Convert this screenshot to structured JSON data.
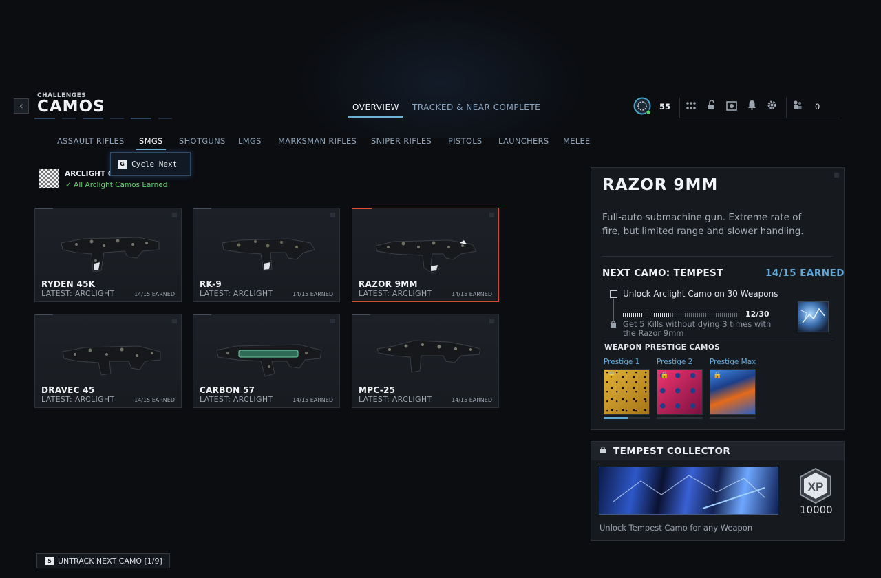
{
  "header": {
    "breadcrumb": "CHALLENGES",
    "title": "CAMOS",
    "back_icon": "chevron-left-icon",
    "tabs": [
      {
        "label": "OVERVIEW",
        "active": true
      },
      {
        "label": "TRACKED & NEAR COMPLETE",
        "active": false
      }
    ],
    "level": "55",
    "party_count": "0"
  },
  "weapon_classes": [
    "ASSAULT RIFLES",
    "SMGS",
    "SHOTGUNS",
    "LMGS",
    "MARKSMAN RIFLES",
    "SNIPER RIFLES",
    "PISTOLS",
    "LAUNCHERS",
    "MELEE"
  ],
  "active_class": "SMGS",
  "tooltip": {
    "key": "G",
    "label": "Cycle Next"
  },
  "arclight": {
    "title": "ARCLIGHT CA",
    "status": "All Arclight Camos Earned"
  },
  "weapons": [
    {
      "name": "RYDEN 45K",
      "latest": "LATEST: ARCLIGHT",
      "earned": "14/15 EARNED",
      "selected": false
    },
    {
      "name": "RK-9",
      "latest": "LATEST: ARCLIGHT",
      "earned": "14/15 EARNED",
      "selected": false
    },
    {
      "name": "RAZOR 9MM",
      "latest": "LATEST: ARCLIGHT",
      "earned": "14/15 EARNED",
      "selected": true
    },
    {
      "name": "DRAVEC 45",
      "latest": "LATEST: ARCLIGHT",
      "earned": "14/15 EARNED",
      "selected": false
    },
    {
      "name": "CARBON 57",
      "latest": "LATEST: ARCLIGHT",
      "earned": "14/15 EARNED",
      "selected": false
    },
    {
      "name": "MPC-25",
      "latest": "LATEST: ARCLIGHT",
      "earned": "14/15 EARNED",
      "selected": false
    }
  ],
  "details": {
    "title": "RAZOR 9MM",
    "description": "Full-auto submachine gun. Extreme rate of fire, but limited range and slower handling.",
    "next_camo_label": "NEXT CAMO: TEMPEST",
    "next_camo_earned": "14/15 EARNED",
    "requirement_1": "Unlock Arclight Camo on 30 Weapons",
    "progress_text": "12/30",
    "progress_fraction": 0.4,
    "requirement_2": "Get 5 Kills without dying 3 times with the Razor 9mm",
    "prestige_heading": "WEAPON PRESTIGE CAMOS",
    "prestige": [
      {
        "label": "Prestige 1",
        "colors": [
          "#c9962a",
          "#1a1208"
        ]
      },
      {
        "label": "Prestige 2",
        "colors": [
          "#e0285f",
          "#1b3f8a"
        ]
      },
      {
        "label": "Prestige Max",
        "colors": [
          "#2f7ad8",
          "#e46a1a"
        ]
      }
    ]
  },
  "collector": {
    "title": "TEMPEST COLLECTOR",
    "xp_label": "XP",
    "xp_amount": "10000",
    "description": "Unlock Tempest Camo for any Weapon"
  },
  "footer": {
    "key": "5",
    "untrack_label": "UNTRACK NEXT CAMO [1/9]"
  },
  "colors": {
    "accent_blue": "#6fb2d9",
    "selected_orange": "#e0502c",
    "success_green": "#5fd36a"
  }
}
